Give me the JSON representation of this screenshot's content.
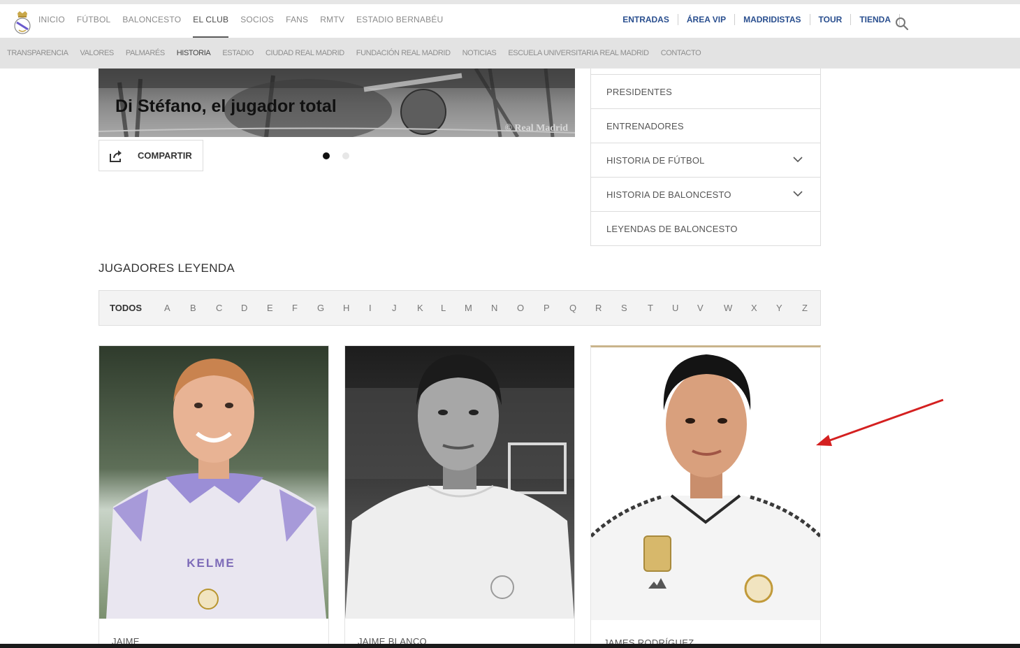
{
  "nav": {
    "primary": [
      "INICIO",
      "FÚTBOL",
      "BALONCESTO",
      "EL CLUB",
      "SOCIOS",
      "FANS",
      "RMTV",
      "ESTADIO BERNABÉU"
    ],
    "secondary": [
      "ENTRADAS",
      "ÁREA VIP",
      "MADRIDISTAS",
      "TOUR",
      "TIENDA"
    ]
  },
  "subnav": [
    "TRANSPARENCIA",
    "VALORES",
    "PALMARÉS",
    "HISTORIA",
    "ESTADIO",
    "CIUDAD REAL MADRID",
    "FUNDACIÓN REAL MADRID",
    "NOTICIAS",
    "ESCUELA UNIVERSITARIA REAL MADRID",
    "CONTACTO"
  ],
  "hero": {
    "title": "Di Stéfano, el jugador total",
    "credit": "© Real Madrid"
  },
  "share": {
    "label": "COMPARTIR"
  },
  "side_menu": [
    "PRESIDENTES",
    "ENTRENADORES",
    "HISTORIA DE FÚTBOL",
    "HISTORIA DE BALONCESTO",
    "LEYENDAS DE BALONCESTO"
  ],
  "section": {
    "title": "JUGADORES LEYENDA"
  },
  "alphabet": [
    "TODOS",
    "A",
    "B",
    "C",
    "D",
    "E",
    "F",
    "G",
    "H",
    "I",
    "J",
    "K",
    "L",
    "M",
    "N",
    "O",
    "P",
    "Q",
    "R",
    "S",
    "T",
    "U",
    "V",
    "W",
    "X",
    "Y",
    "Z"
  ],
  "cards": [
    {
      "name": "JAIME",
      "shirt_text": "KELME"
    },
    {
      "name": "JAIME BLANCO"
    },
    {
      "name": "JAMES RODRÍGUEZ"
    }
  ],
  "colors": {
    "link_blue": "#2a4f8f",
    "annotation_arrow": "#d42020",
    "featured_border": "#c9b48c"
  }
}
